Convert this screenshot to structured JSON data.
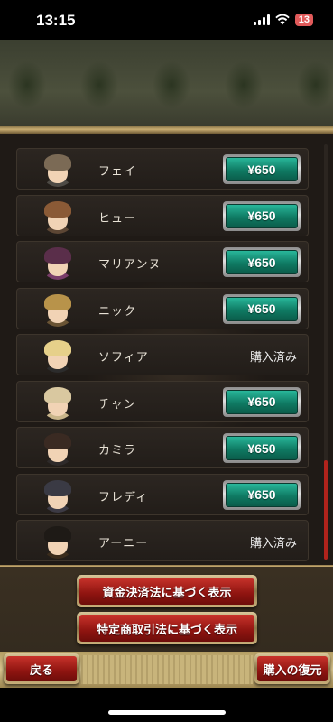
{
  "status": {
    "time": "13:15",
    "battery": "13"
  },
  "products": [
    {
      "name": "フェイ",
      "price": "¥650",
      "purchased": false,
      "hair": "#7b6a55",
      "outfit": "#4d4a45"
    },
    {
      "name": "ヒュー",
      "price": "¥650",
      "purchased": false,
      "hair": "#8a5a36",
      "outfit": "#5c4634"
    },
    {
      "name": "マリアンヌ",
      "price": "¥650",
      "purchased": false,
      "hair": "#5a2e4a",
      "outfit": "#7a3d6a"
    },
    {
      "name": "ニック",
      "price": "¥650",
      "purchased": false,
      "hair": "#b8934a",
      "outfit": "#6a5434"
    },
    {
      "name": "ソフィア",
      "price": "購入済み",
      "purchased": true,
      "hair": "#e6d08a",
      "outfit": "#2c2c2c"
    },
    {
      "name": "チャン",
      "price": "¥650",
      "purchased": false,
      "hair": "#d9c8a0",
      "outfit": "#c9b58a"
    },
    {
      "name": "カミラ",
      "price": "¥650",
      "purchased": false,
      "hair": "#3a2a22",
      "outfit": "#2e2a2a"
    },
    {
      "name": "フレディ",
      "price": "¥650",
      "purchased": false,
      "hair": "#3a3a44",
      "outfit": "#3c3a44"
    },
    {
      "name": "アーニー",
      "price": "購入済み",
      "purchased": true,
      "hair": "#1e1a16",
      "outfit": "#3a2c1c"
    }
  ],
  "buttons": {
    "funds_settlement": "資金決済法に基づく表示",
    "commercial_transactions": "特定商取引法に基づく表示",
    "back": "戻る",
    "restore": "購入の復元"
  },
  "colors": {
    "price_button": "#0f7a63",
    "red_button": "#8e1410",
    "scroll_thumb": "#b0231c"
  }
}
